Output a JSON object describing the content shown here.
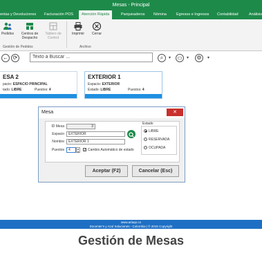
{
  "window": {
    "title": "Mesas - Principal"
  },
  "tabs": [
    {
      "label": "entas y Devoluciones"
    },
    {
      "label": "Facturación POS"
    },
    {
      "label": "Atención Rápida"
    },
    {
      "label": "Parqueaderos"
    },
    {
      "label": "Nómina"
    },
    {
      "label": "Egresos e Ingresos"
    },
    {
      "label": "Contabilidad"
    },
    {
      "label": "Análisis"
    }
  ],
  "ribbon": {
    "pedidos": "Pedidos",
    "centros_line1": "Centros de",
    "centros_line2": "Despacho",
    "tablero_line1": "Tablero de",
    "tablero_line2": "Control",
    "imprimir": "Imprimir",
    "cerrar": "Cerrar",
    "group1": "Gestión de Pedidos",
    "group2": "Archivo"
  },
  "search": {
    "placeholder": "Texto a Buscar ..."
  },
  "tables": [
    {
      "title": "ESA 2",
      "espacio_label": "pacio:",
      "espacio_value": "ESPACIO PRINCIPAL",
      "estado_label": "tado:",
      "estado_value": "LIBRE",
      "puestos_label": "Puestos:",
      "puestos_value": "4"
    },
    {
      "title": "EXTERIOR 1",
      "espacio_label": "Espacio:",
      "espacio_value": "EXTERIOR",
      "estado_label": "Estado:",
      "estado_value": "LIBRE",
      "puestos_label": "Puestos:",
      "puestos_value": "4"
    }
  ],
  "dialog": {
    "title": "Mesa",
    "close": "✕",
    "id_label": "ID Mesa",
    "id_value": "3",
    "espacio_label": "Espacio",
    "espacio_value": "EXTERIOR",
    "nombre_label": "Nombre",
    "nombre_value": "EXTERIOR 1",
    "puestos_label": "Puestos",
    "puestos_value": "4",
    "cambio_label": "Cambio Automático de estado",
    "estado_label": "Estado",
    "estados": [
      "LIBRE",
      "RESERVADA",
      "OCUPADA"
    ],
    "aceptar": "Aceptar (F2)",
    "cancelar": "Cancelar (Esc)"
  },
  "footer": {
    "line1": "www.ariaqo.co",
    "line2": "Docenter's y Azul Soluciones - Colombia | © 2015 Copyright"
  },
  "caption": "Gestión de Mesas"
}
